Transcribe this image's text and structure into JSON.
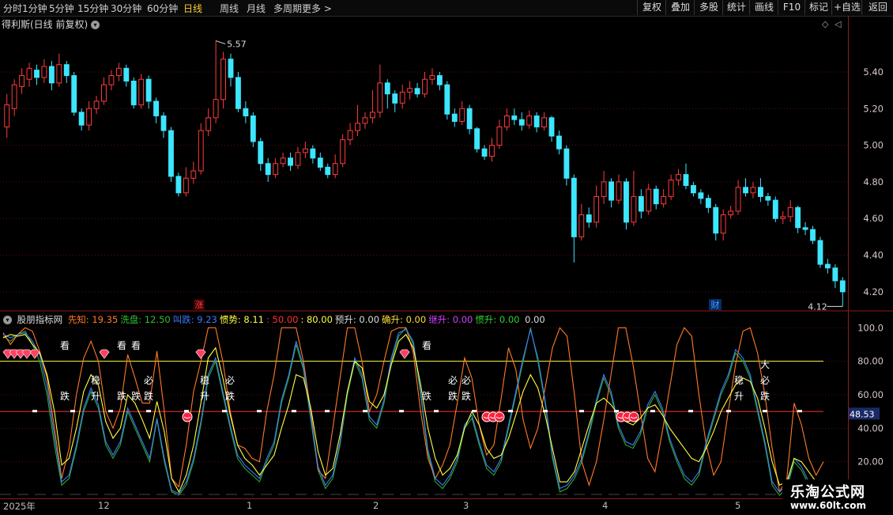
{
  "toolbar": {
    "periods": [
      "分时",
      "1分钟",
      "5分钟",
      "15分钟",
      "30分钟",
      "60分钟",
      "日线",
      "周线",
      "月线",
      "多周期",
      "更多"
    ],
    "active": "日线",
    "right_buttons": [
      "复权",
      "叠加",
      "多股",
      "统计",
      "画线",
      "F10",
      "标记",
      "+自选",
      "返回"
    ]
  },
  "title": {
    "stock": "得利斯(日线 前复权)"
  },
  "price_chart": {
    "ylabels": [
      "5.40",
      "5.20",
      "5.00",
      "4.80",
      "4.60",
      "4.40",
      "4.20"
    ],
    "ylevels": [
      5.4,
      5.2,
      5.0,
      4.8,
      4.6,
      4.4,
      4.2
    ],
    "ylim": [
      4.1,
      5.62
    ],
    "high_annotation": "5.57",
    "low_annotation": "4.12",
    "markers": [
      {
        "text": "涨",
        "color": "#ff4040"
      },
      {
        "text": "财",
        "color": "#3aa0ff"
      }
    ],
    "up_color": "#ff3c3c",
    "down_color": "#3ce6ff"
  },
  "indicator": {
    "name": "股朋指标网",
    "legend": [
      {
        "label": "先知:",
        "value": "19.35",
        "color": "#ff7a28"
      },
      {
        "label": "洗盘:",
        "value": "12.50",
        "color": "#2fbf2f"
      },
      {
        "label": "叫跌:",
        "value": "9.23",
        "color": "#3a7bff"
      },
      {
        "label": "惯势:",
        "value": "8.11",
        "color": "#ffff40"
      },
      {
        "label": ":",
        "value": "50.00",
        "color": "#ff3030"
      },
      {
        "label": ":",
        "value": "80.00",
        "color": "#ffff40"
      },
      {
        "label": "预升:",
        "value": "0.00",
        "color": "#dddddd"
      },
      {
        "label": "确升:",
        "value": "0.00",
        "color": "#ffdd33"
      },
      {
        "label": "继升:",
        "value": "0.00",
        "color": "#d040ff"
      },
      {
        "label": "惯升:",
        "value": "0.00",
        "color": "#30d030"
      },
      {
        "label": "",
        "value": "0.00",
        "color": "#dddddd"
      }
    ],
    "ylabels": [
      "100.0",
      "80.00",
      "60.00",
      "40.00",
      "20.00"
    ],
    "ylevels": [
      100,
      80,
      60,
      40,
      20
    ],
    "ylim": [
      0,
      103
    ],
    "current_value": "48.53",
    "signal_texts": [
      "看",
      "看",
      "看",
      "看",
      "跌",
      "稳",
      "升",
      "跌",
      "跌",
      "必",
      "跌",
      "稳",
      "升",
      "必",
      "跌",
      "跌",
      "必",
      "跌",
      "必",
      "跌",
      "稳",
      "升",
      "大",
      "必",
      "跌"
    ]
  },
  "dates": [
    "2025年",
    "12",
    "1",
    "2",
    "3",
    "4",
    "5"
  ],
  "watermark": {
    "line1": "乐淘公式网",
    "line2": "www.60lt.com"
  },
  "chart_data": {
    "type": "line",
    "title": "",
    "price_candles": [
      [
        5.1,
        5.22,
        5.28,
        5.04
      ],
      [
        5.2,
        5.33,
        5.36,
        5.16
      ],
      [
        5.32,
        5.38,
        5.42,
        5.28
      ],
      [
        5.36,
        5.42,
        5.45,
        5.32
      ],
      [
        5.41,
        5.37,
        5.44,
        5.33
      ],
      [
        5.37,
        5.43,
        5.47,
        5.34
      ],
      [
        5.43,
        5.34,
        5.46,
        5.3
      ],
      [
        5.34,
        5.44,
        5.5,
        5.32
      ],
      [
        5.44,
        5.38,
        5.46,
        5.34
      ],
      [
        5.38,
        5.18,
        5.4,
        5.16
      ],
      [
        5.18,
        5.11,
        5.2,
        5.08
      ],
      [
        5.11,
        5.2,
        5.24,
        5.08
      ],
      [
        5.2,
        5.24,
        5.27,
        5.17
      ],
      [
        5.24,
        5.33,
        5.37,
        5.22
      ],
      [
        5.33,
        5.38,
        5.41,
        5.3
      ],
      [
        5.38,
        5.42,
        5.45,
        5.35
      ],
      [
        5.42,
        5.35,
        5.44,
        5.32
      ],
      [
        5.35,
        5.22,
        5.37,
        5.2
      ],
      [
        5.22,
        5.36,
        5.39,
        5.2
      ],
      [
        5.36,
        5.24,
        5.38,
        5.2
      ],
      [
        5.24,
        5.16,
        5.26,
        5.12
      ],
      [
        5.16,
        5.08,
        5.18,
        5.04
      ],
      [
        5.08,
        4.83,
        5.1,
        4.8
      ],
      [
        4.83,
        4.74,
        4.85,
        4.72
      ],
      [
        4.74,
        4.82,
        4.88,
        4.72
      ],
      [
        4.82,
        4.86,
        4.91,
        4.79
      ],
      [
        4.86,
        5.08,
        5.12,
        4.84
      ],
      [
        5.08,
        5.15,
        5.2,
        5.05
      ],
      [
        5.15,
        5.25,
        5.57,
        5.12
      ],
      [
        5.25,
        5.47,
        5.51,
        5.2
      ],
      [
        5.47,
        5.37,
        5.5,
        5.32
      ],
      [
        5.37,
        5.2,
        5.4,
        5.18
      ],
      [
        5.2,
        5.16,
        5.24,
        5.12
      ],
      [
        5.16,
        5.02,
        5.18,
        4.99
      ],
      [
        5.02,
        4.9,
        5.04,
        4.86
      ],
      [
        4.9,
        4.84,
        4.93,
        4.8
      ],
      [
        4.84,
        4.9,
        4.93,
        4.82
      ],
      [
        4.9,
        4.93,
        4.96,
        4.88
      ],
      [
        4.93,
        4.89,
        4.96,
        4.86
      ],
      [
        4.89,
        4.96,
        4.99,
        4.87
      ],
      [
        4.96,
        4.98,
        5.02,
        4.93
      ],
      [
        4.98,
        4.93,
        5.0,
        4.9
      ],
      [
        4.93,
        4.88,
        4.96,
        4.86
      ],
      [
        4.88,
        4.84,
        4.9,
        4.82
      ],
      [
        4.84,
        4.9,
        4.95,
        4.82
      ],
      [
        4.9,
        5.03,
        5.06,
        4.88
      ],
      [
        5.03,
        5.08,
        5.12,
        5.0
      ],
      [
        5.08,
        5.12,
        5.22,
        5.05
      ],
      [
        5.12,
        5.15,
        5.18,
        5.09
      ],
      [
        5.15,
        5.18,
        5.3,
        5.12
      ],
      [
        5.18,
        5.34,
        5.44,
        5.15
      ],
      [
        5.34,
        5.28,
        5.36,
        5.2
      ],
      [
        5.28,
        5.23,
        5.3,
        5.18
      ],
      [
        5.23,
        5.29,
        5.33,
        5.2
      ],
      [
        5.29,
        5.31,
        5.35,
        5.25
      ],
      [
        5.31,
        5.28,
        5.34,
        5.26
      ],
      [
        5.28,
        5.36,
        5.4,
        5.26
      ],
      [
        5.36,
        5.38,
        5.42,
        5.33
      ],
      [
        5.38,
        5.33,
        5.4,
        5.3
      ],
      [
        5.33,
        5.17,
        5.35,
        5.14
      ],
      [
        5.17,
        5.13,
        5.2,
        5.1
      ],
      [
        5.13,
        5.2,
        5.24,
        5.11
      ],
      [
        5.2,
        5.09,
        5.22,
        5.06
      ],
      [
        5.09,
        4.98,
        5.1,
        4.96
      ],
      [
        4.98,
        4.94,
        5.0,
        4.92
      ],
      [
        4.94,
        5.0,
        5.04,
        4.91
      ],
      [
        5.0,
        5.1,
        5.14,
        4.98
      ],
      [
        5.1,
        5.16,
        5.2,
        5.08
      ],
      [
        5.16,
        5.14,
        5.2,
        5.11
      ],
      [
        5.14,
        5.11,
        5.18,
        5.08
      ],
      [
        5.11,
        5.16,
        5.19,
        5.09
      ],
      [
        5.16,
        5.1,
        5.18,
        5.07
      ],
      [
        5.1,
        5.15,
        5.18,
        5.08
      ],
      [
        5.15,
        5.05,
        5.16,
        5.02
      ],
      [
        5.05,
        4.98,
        5.08,
        4.95
      ],
      [
        4.98,
        4.82,
        5.0,
        4.78
      ],
      [
        4.82,
        4.5,
        4.84,
        4.36
      ],
      [
        4.5,
        4.62,
        4.68,
        4.48
      ],
      [
        4.62,
        4.58,
        4.66,
        4.55
      ],
      [
        4.58,
        4.72,
        4.78,
        4.55
      ],
      [
        4.72,
        4.8,
        4.86,
        4.68
      ],
      [
        4.8,
        4.7,
        4.82,
        4.66
      ],
      [
        4.7,
        4.8,
        4.84,
        4.68
      ],
      [
        4.8,
        4.58,
        4.82,
        4.54
      ],
      [
        4.58,
        4.72,
        4.86,
        4.56
      ],
      [
        4.72,
        4.64,
        4.76,
        4.6
      ],
      [
        4.64,
        4.76,
        4.79,
        4.62
      ],
      [
        4.76,
        4.68,
        4.78,
        4.65
      ],
      [
        4.68,
        4.72,
        4.76,
        4.66
      ],
      [
        4.72,
        4.81,
        4.84,
        4.7
      ],
      [
        4.81,
        4.84,
        4.87,
        4.78
      ],
      [
        4.84,
        4.78,
        4.9,
        4.76
      ],
      [
        4.78,
        4.74,
        4.8,
        4.72
      ],
      [
        4.74,
        4.71,
        4.76,
        4.68
      ],
      [
        4.71,
        4.66,
        4.73,
        4.63
      ],
      [
        4.66,
        4.52,
        4.68,
        4.48
      ],
      [
        4.52,
        4.62,
        4.65,
        4.48
      ],
      [
        4.62,
        4.64,
        4.67,
        4.6
      ],
      [
        4.64,
        4.77,
        4.81,
        4.62
      ],
      [
        4.77,
        4.74,
        4.82,
        4.72
      ],
      [
        4.74,
        4.77,
        4.8,
        4.71
      ],
      [
        4.77,
        4.72,
        4.82,
        4.69
      ],
      [
        4.72,
        4.7,
        4.74,
        4.67
      ],
      [
        4.7,
        4.6,
        4.72,
        4.58
      ],
      [
        4.6,
        4.61,
        4.64,
        4.57
      ],
      [
        4.61,
        4.66,
        4.7,
        4.58
      ],
      [
        4.66,
        4.55,
        4.67,
        4.52
      ],
      [
        4.55,
        4.54,
        4.58,
        4.51
      ],
      [
        4.54,
        4.48,
        4.56,
        4.46
      ],
      [
        4.48,
        4.35,
        4.5,
        4.33
      ],
      [
        4.35,
        4.33,
        4.38,
        4.3
      ],
      [
        4.33,
        4.26,
        4.35,
        4.22
      ],
      [
        4.26,
        4.2,
        4.28,
        4.12
      ]
    ],
    "xian_zhi": [
      97,
      90,
      96,
      100,
      98,
      86,
      70,
      40,
      10,
      28,
      60,
      82,
      92,
      80,
      50,
      40,
      52,
      84,
      70,
      55,
      55,
      86,
      50,
      10,
      5,
      30,
      62,
      80,
      100,
      100,
      80,
      50,
      30,
      28,
      22,
      20,
      50,
      72,
      100,
      100,
      100,
      80,
      50,
      15,
      10,
      40,
      70,
      100,
      100,
      80,
      50,
      60,
      80,
      98,
      100,
      100,
      85,
      50,
      22,
      10,
      18,
      30,
      55,
      82,
      70,
      42,
      24,
      30,
      58,
      88,
      75,
      45,
      28,
      40,
      64,
      88,
      100,
      95,
      60,
      20,
      6,
      20,
      45,
      72,
      100,
      100,
      78,
      50,
      22,
      14,
      38,
      64,
      90,
      100,
      95,
      60,
      30,
      12,
      20,
      50,
      78,
      98,
      100,
      85,
      60,
      28,
      2,
      10,
      55,
      42,
      22,
      12,
      20
    ],
    "xi_pan": [
      95,
      92,
      96,
      98,
      90,
      80,
      60,
      30,
      6,
      10,
      28,
      50,
      62,
      52,
      30,
      22,
      30,
      50,
      40,
      30,
      20,
      45,
      20,
      2,
      0,
      6,
      20,
      42,
      70,
      80,
      60,
      40,
      22,
      16,
      12,
      8,
      20,
      30,
      55,
      70,
      90,
      75,
      45,
      15,
      4,
      10,
      30,
      60,
      80,
      70,
      45,
      40,
      55,
      80,
      95,
      100,
      90,
      60,
      25,
      8,
      4,
      10,
      20,
      40,
      46,
      30,
      16,
      12,
      20,
      40,
      60,
      80,
      100,
      80,
      55,
      22,
      2,
      4,
      10,
      20,
      36,
      55,
      70,
      60,
      40,
      30,
      28,
      36,
      52,
      60,
      50,
      32,
      20,
      10,
      6,
      12,
      30,
      45,
      60,
      70,
      85,
      80,
      70,
      50,
      30,
      6,
      0,
      4,
      20,
      15,
      6,
      2,
      4
    ],
    "jiao_die": [
      96,
      94,
      96,
      97,
      92,
      84,
      65,
      35,
      8,
      12,
      30,
      52,
      64,
      54,
      32,
      24,
      32,
      52,
      42,
      32,
      22,
      46,
      22,
      3,
      1,
      8,
      22,
      44,
      72,
      82,
      62,
      42,
      24,
      18,
      14,
      10,
      22,
      32,
      57,
      72,
      92,
      77,
      47,
      17,
      6,
      12,
      32,
      62,
      82,
      72,
      47,
      42,
      57,
      82,
      97,
      99,
      92,
      62,
      27,
      10,
      6,
      12,
      22,
      42,
      48,
      32,
      18,
      14,
      22,
      42,
      62,
      82,
      99,
      82,
      57,
      24,
      4,
      6,
      12,
      22,
      38,
      57,
      72,
      62,
      42,
      32,
      30,
      38,
      54,
      62,
      52,
      34,
      22,
      12,
      8,
      14,
      32,
      47,
      62,
      72,
      87,
      82,
      72,
      52,
      32,
      8,
      2,
      6,
      22,
      17,
      8,
      4,
      9
    ],
    "guan_shi": [
      94,
      96,
      95,
      96,
      90,
      85,
      72,
      50,
      18,
      22,
      40,
      62,
      72,
      66,
      44,
      34,
      40,
      60,
      55,
      45,
      34,
      56,
      38,
      10,
      2,
      12,
      30,
      55,
      82,
      88,
      70,
      48,
      30,
      22,
      18,
      12,
      18,
      24,
      40,
      54,
      72,
      70,
      52,
      26,
      12,
      16,
      36,
      62,
      80,
      76,
      56,
      52,
      60,
      78,
      92,
      96,
      88,
      66,
      40,
      22,
      12,
      16,
      24,
      40,
      50,
      42,
      28,
      22,
      24,
      34,
      48,
      62,
      72,
      64,
      48,
      28,
      8,
      8,
      14,
      28,
      42,
      55,
      58,
      54,
      48,
      44,
      42,
      46,
      52,
      54,
      48,
      40,
      34,
      28,
      22,
      20,
      28,
      38,
      50,
      58,
      66,
      70,
      68,
      58,
      40,
      20,
      6,
      8,
      22,
      20,
      14,
      8,
      8
    ],
    "ref_line_red": 50,
    "ref_line_yellow": 80
  }
}
